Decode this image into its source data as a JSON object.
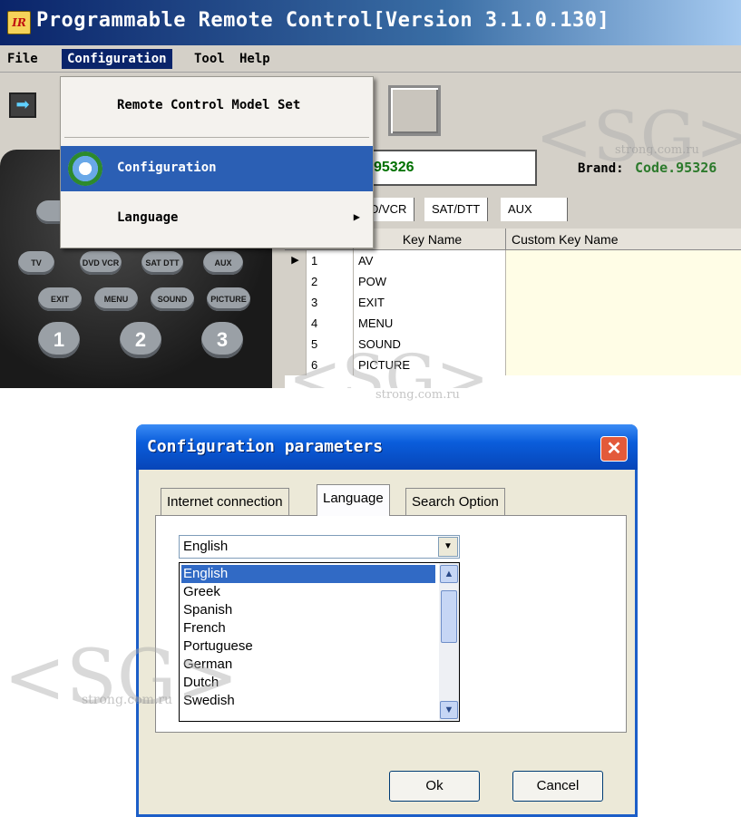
{
  "app": {
    "logo_text": "IR",
    "title": "Programmable Remote Control[Version 3.1.0.130]"
  },
  "menubar": {
    "file": "File",
    "configuration": "Configuration",
    "tool": "Tool",
    "help": "Help"
  },
  "config_menu": {
    "items": [
      {
        "label": "Remote Control Model Set"
      },
      {
        "label": "Configuration",
        "icon": "gear-icon",
        "highlighted": true
      },
      {
        "label": "Language",
        "has_submenu": true
      }
    ]
  },
  "remote": {
    "mode_buttons": [
      "TV",
      "DVD VCR",
      "SAT DTT",
      "AUX"
    ],
    "function_buttons": [
      "EXIT",
      "MENU",
      "SOUND",
      "PICTURE"
    ],
    "numbers": [
      "1",
      "2",
      "3"
    ]
  },
  "code": {
    "input_value": "95326",
    "brand_label": "Brand:",
    "brand_value": "Code.95326"
  },
  "device_tabs": [
    "D/VCR",
    "SAT/DTT",
    "AUX"
  ],
  "key_table": {
    "headers": [
      "Key Name",
      "Custom Key Name"
    ],
    "rows": [
      {
        "num": "1",
        "name": "AV",
        "custom": "",
        "current": true
      },
      {
        "num": "2",
        "name": "POW",
        "custom": ""
      },
      {
        "num": "3",
        "name": "EXIT",
        "custom": ""
      },
      {
        "num": "4",
        "name": "MENU",
        "custom": ""
      },
      {
        "num": "5",
        "name": "SOUND",
        "custom": ""
      },
      {
        "num": "6",
        "name": "PICTURE",
        "custom": ""
      }
    ]
  },
  "watermark": {
    "logo": "<SG>",
    "site": "strong.com.ru"
  },
  "dialog": {
    "title": "Configuration parameters",
    "close": "✕",
    "tabs": [
      "Internet connection",
      "Language",
      "Search Option"
    ],
    "active_tab": "Language",
    "language_select": {
      "value": "English",
      "options": [
        "English",
        "Greek",
        "Spanish",
        "French",
        "Portuguese",
        "German",
        "Dutch",
        "Swedish"
      ],
      "selected": "English"
    },
    "ok_label": "Ok",
    "cancel_label": "Cancel"
  },
  "colors": {
    "title_bar": "#0a246a",
    "dialog_title_bar": "#0a5ddb",
    "menu_highlight": "#2b5fb4",
    "list_selection": "#316ac5",
    "close_button": "#e35a3a",
    "code_green": "#007000"
  }
}
